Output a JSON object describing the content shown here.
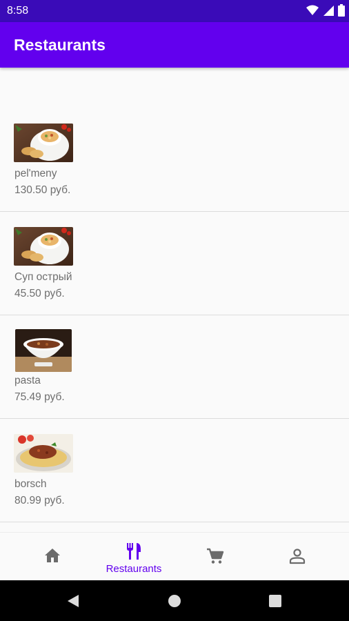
{
  "status_bar": {
    "time": "8:58",
    "icons": [
      "wifi-icon",
      "signal-icon",
      "battery-icon"
    ]
  },
  "app_bar": {
    "title": "Restaurants"
  },
  "menu_items": [
    {
      "name": "pel'meny",
      "price": "130.50 руб.",
      "image": "soup-bowl-with-bread"
    },
    {
      "name": "Суп острый",
      "price": "45.50 руб.",
      "image": "soup-bowl-with-bread"
    },
    {
      "name": "pasta",
      "price": "75.49 руб.",
      "image": "soup-in-white-bowl"
    },
    {
      "name": "borsch",
      "price": "80.99 руб.",
      "image": "spaghetti-bolognese"
    }
  ],
  "bottom_nav": {
    "items": [
      {
        "icon": "home-icon",
        "label": "",
        "active": false
      },
      {
        "icon": "restaurant-icon",
        "label": "Restaurants",
        "active": true
      },
      {
        "icon": "cart-icon",
        "label": "",
        "active": false
      },
      {
        "icon": "person-icon",
        "label": "",
        "active": false
      }
    ]
  },
  "colors": {
    "primary": "#6200ee",
    "status_bar": "#3a0bb8",
    "inactive_icon": "#6b6b6b",
    "text_secondary": "#6e6e6e"
  }
}
